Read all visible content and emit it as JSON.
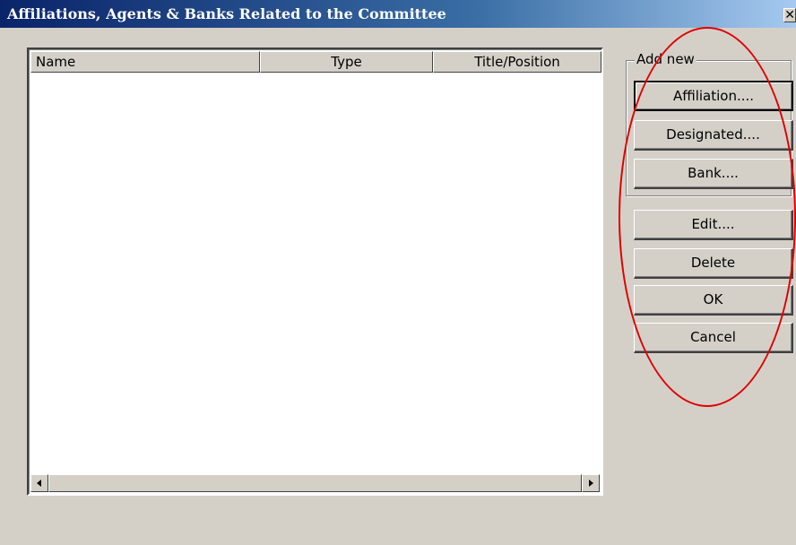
{
  "window": {
    "title": "Affiliations, Agents & Banks Related to the Committee",
    "close_glyph": "✕"
  },
  "list": {
    "columns": [
      "Name",
      "Type",
      "Title/Position"
    ],
    "rows": []
  },
  "add_new": {
    "label": "Add new",
    "buttons": [
      "Affiliation....",
      "Designated....",
      "Bank...."
    ]
  },
  "actions": {
    "edit": "Edit....",
    "delete": "Delete",
    "ok": "OK",
    "cancel": "Cancel"
  },
  "colors": {
    "title_start": "#0a246a",
    "title_end": "#a6caf0",
    "face": "#d4d0c8",
    "annotation": "#e00000"
  }
}
